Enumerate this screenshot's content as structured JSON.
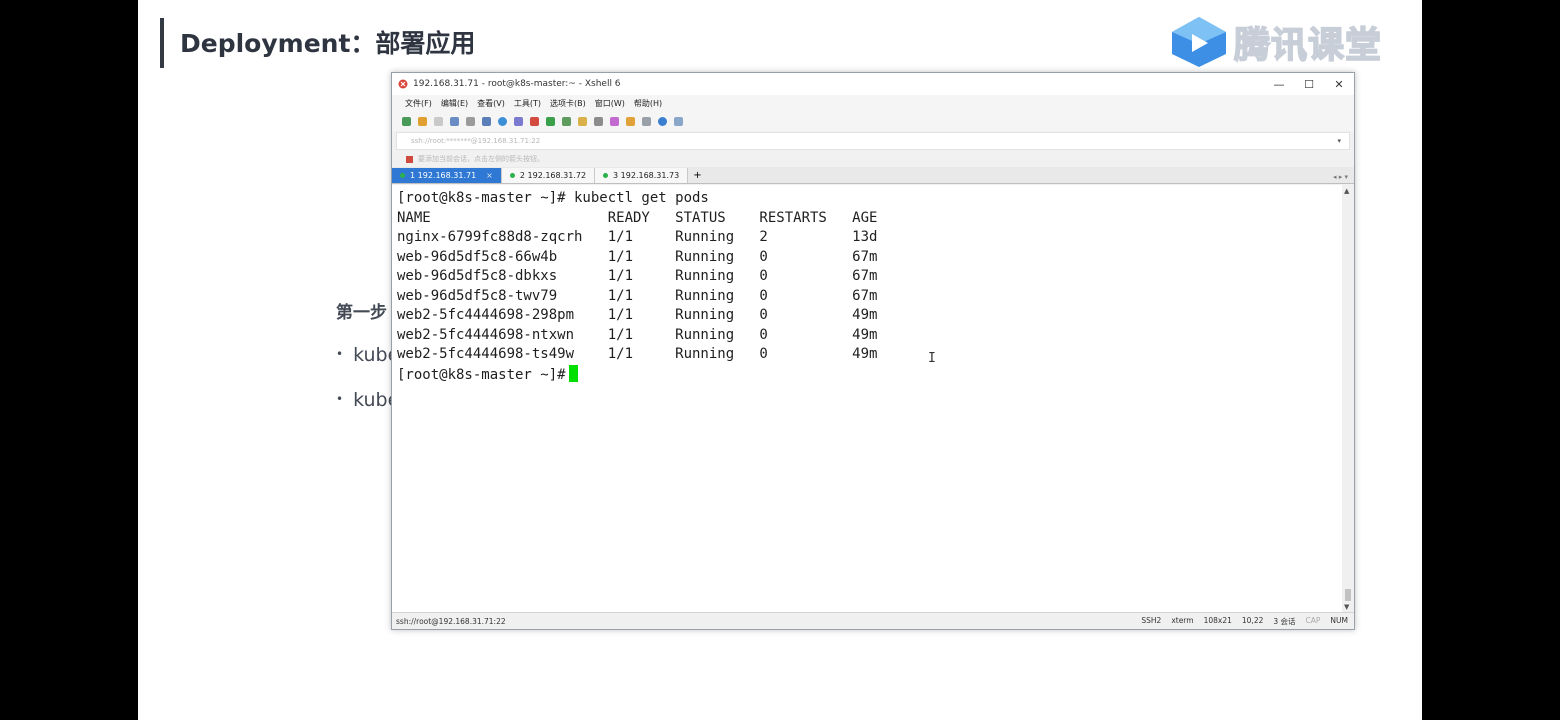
{
  "slide": {
    "title": "Deployment：部署应用",
    "logo_text": "腾讯课堂",
    "step_label": "第一步",
    "bullets": [
      "kube",
      "kube"
    ]
  },
  "window": {
    "title": "192.168.31.71 - root@k8s-master:~ - Xshell 6",
    "minimize": "—",
    "maximize": "☐",
    "close": "✕",
    "menu": [
      "文件(F)",
      "编辑(E)",
      "查看(V)",
      "工具(T)",
      "选项卡(B)",
      "窗口(W)",
      "帮助(H)"
    ],
    "address": "ssh://root:*******@192.168.31.71:22",
    "hint": "要添加当前会话，点击左侧的箭头按钮。",
    "tabs": [
      {
        "label": "1 192.168.31.71",
        "active": true
      },
      {
        "label": "2 192.168.31.72",
        "active": false
      },
      {
        "label": "3 192.168.31.73",
        "active": false
      }
    ],
    "tab_close": "×",
    "tab_add": "+"
  },
  "terminal": {
    "lines": [
      "[root@k8s-master ~]# kubectl get pods",
      "NAME                     READY   STATUS    RESTARTS   AGE",
      "nginx-6799fc88d8-zqcrh   1/1     Running   2          13d",
      "web-96d5df5c8-66w4b      1/1     Running   0          67m",
      "web-96d5df5c8-dbkxs      1/1     Running   0          67m",
      "web-96d5df5c8-twv79      1/1     Running   0          67m",
      "web2-5fc4444698-298pm    1/1     Running   0          49m",
      "web2-5fc4444698-ntxwn    1/1     Running   0          49m",
      "web2-5fc4444698-ts49w    1/1     Running   0          49m"
    ],
    "prompt": "[root@k8s-master ~]#",
    "cursor_color": "#00e000"
  },
  "statusbar": {
    "connection": "ssh://root@192.168.31.71:22",
    "protocol": "SSH2",
    "term": "xterm",
    "size": "108x21",
    "position": "10,22",
    "sessions": "3 会话",
    "caps": "CAP",
    "num": "NUM"
  },
  "colors": {
    "active_tab": "#2f78d4",
    "online_dot": "#2bb24c"
  }
}
